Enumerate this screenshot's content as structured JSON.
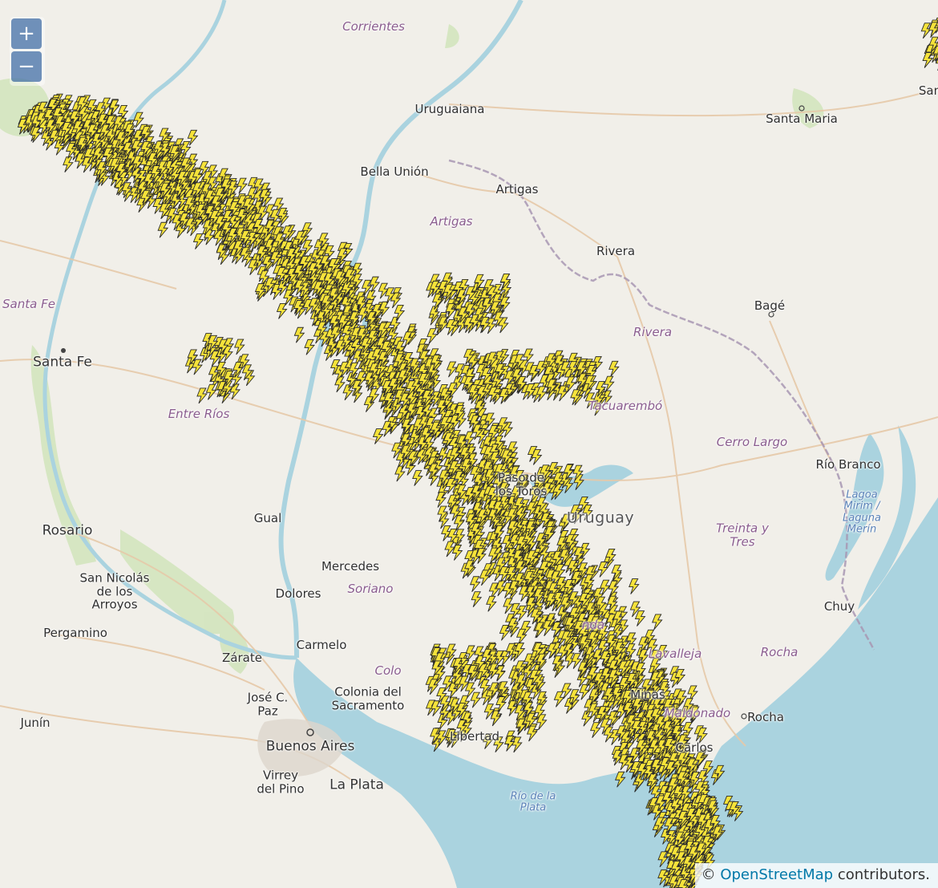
{
  "map": {
    "controls": {
      "zoom_in": "+",
      "zoom_out": "−"
    },
    "attribution": {
      "prefix": "©",
      "link": "OpenStreetMap",
      "suffix": " contributors."
    },
    "colors": {
      "land": "#f1efe9",
      "water": "#aad3df",
      "border": "#9a8fa3",
      "road": "#e8c9a7",
      "green": "#c9dfb0",
      "lightning": "#f5e23a",
      "lightning_outline": "#2a2a2a"
    },
    "marker_icon": "lightning-bolt-icon",
    "places": [
      {
        "id": "corrientes",
        "label": "Corrientes",
        "type": "region"
      },
      {
        "id": "uruguaiana",
        "label": "Uruguaiana",
        "type": "city"
      },
      {
        "id": "santa-maria",
        "label": "Santa Maria",
        "type": "city"
      },
      {
        "id": "bella-union",
        "label": "Bella Unión",
        "type": "city"
      },
      {
        "id": "artigas",
        "label": "Artigas",
        "type": "city"
      },
      {
        "id": "artigas-dept",
        "label": "Artigas",
        "type": "region"
      },
      {
        "id": "rivera",
        "label": "Rivera",
        "type": "city"
      },
      {
        "id": "rivera-dept",
        "label": "Rivera",
        "type": "region"
      },
      {
        "id": "bage",
        "label": "Bagé",
        "type": "city"
      },
      {
        "id": "santa-fe-prov",
        "label": "Santa Fe",
        "type": "region"
      },
      {
        "id": "santa-fe",
        "label": "Santa Fe",
        "type": "big"
      },
      {
        "id": "entre-rios",
        "label": "Entre Ríos",
        "type": "region"
      },
      {
        "id": "tacuarembo",
        "label": "Tacuarembó",
        "type": "region"
      },
      {
        "id": "cerro-largo",
        "label": "Cerro Largo",
        "type": "region"
      },
      {
        "id": "rio-branco",
        "label": "Río Branco",
        "type": "city"
      },
      {
        "id": "laguna-merin",
        "label": "Lagoa Mirim / Laguna Merín",
        "type": "water"
      },
      {
        "id": "uruguay",
        "label": "Uruguay",
        "type": "country"
      },
      {
        "id": "treinta-y-tres",
        "label": "Treinta y Tres",
        "type": "region"
      },
      {
        "id": "rosario",
        "label": "Rosario",
        "type": "big"
      },
      {
        "id": "paso-de-los-toros",
        "label": "Paso de los Toros",
        "type": "city"
      },
      {
        "id": "san-nicolas",
        "label": "San Nicolás de los Arroyos",
        "type": "city"
      },
      {
        "id": "dolores",
        "label": "Dolores",
        "type": "city"
      },
      {
        "id": "pergamino",
        "label": "Pergamino",
        "type": "city"
      },
      {
        "id": "carmelo",
        "label": "Carmelo",
        "type": "city"
      },
      {
        "id": "zarate",
        "label": "Zárate",
        "type": "city"
      },
      {
        "id": "lavalleja",
        "label": "Lavalleja",
        "type": "region"
      },
      {
        "id": "rocha-dept",
        "label": "Rocha",
        "type": "region"
      },
      {
        "id": "chuy",
        "label": "Chuy",
        "type": "city"
      },
      {
        "id": "jose-c-paz",
        "label": "José C. Paz",
        "type": "city"
      },
      {
        "id": "colonia",
        "label": "Colonia del Sacramento",
        "type": "city"
      },
      {
        "id": "minas",
        "label": "Minas",
        "type": "city"
      },
      {
        "id": "maldonado",
        "label": "Maldonado",
        "type": "region"
      },
      {
        "id": "rocha",
        "label": "Rocha",
        "type": "city"
      },
      {
        "id": "junin",
        "label": "Junín",
        "type": "city"
      },
      {
        "id": "buenos-aires",
        "label": "Buenos Aires",
        "type": "big"
      },
      {
        "id": "san-carlos",
        "label": "Carlos",
        "type": "city"
      },
      {
        "id": "virrey-del-pino",
        "label": "Virrey del Pino",
        "type": "city"
      },
      {
        "id": "la-plata",
        "label": "La Plata",
        "type": "big"
      },
      {
        "id": "rio-de-la-plata",
        "label": "Río de la Plata",
        "type": "water"
      },
      {
        "id": "gualeguaychu",
        "label": "Gual",
        "type": "city"
      },
      {
        "id": "mercedes",
        "label": "Mercedes",
        "type": "city"
      },
      {
        "id": "soriano",
        "label": "Soriano",
        "type": "region"
      },
      {
        "id": "durazno",
        "label": "nda",
        "type": "region"
      },
      {
        "id": "libertad",
        "label": "Libertad",
        "type": "city"
      },
      {
        "id": "colonia-dept",
        "label": "Colo",
        "type": "region"
      },
      {
        "id": "san-partial",
        "label": "San",
        "type": "city"
      }
    ]
  }
}
